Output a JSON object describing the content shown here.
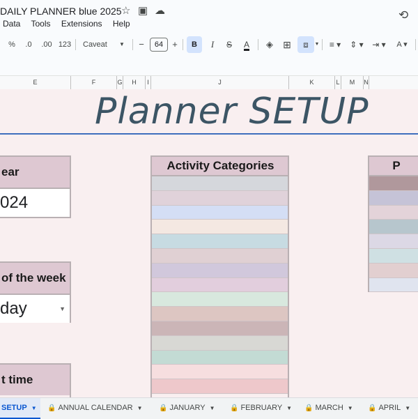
{
  "window": {
    "title": "DAILY PLANNER blue 2025",
    "menu": [
      "Data",
      "Tools",
      "Extensions",
      "Help"
    ]
  },
  "toolbar": {
    "percent": "%",
    "decrease_decimal": ".0",
    "increase_decimal": ".00",
    "number_format": "123",
    "font": "Caveat",
    "font_size": "64",
    "minus": "−",
    "plus": "+",
    "bold": "B",
    "italic": "I",
    "strike": "S",
    "text_color": "A",
    "text_rotate": "A"
  },
  "columns": [
    "E",
    "F",
    "G",
    "H",
    "I",
    "J",
    "K",
    "L",
    "M",
    "N"
  ],
  "banner": {
    "title": "Planner SETUP"
  },
  "year_box": {
    "header": "ear",
    "value": "024"
  },
  "week_box": {
    "header": " of the week",
    "value": "day"
  },
  "time_box": {
    "header": "t time"
  },
  "categories": {
    "header": "Activity Categories",
    "colors": [
      "#d5d7dc",
      "#e0d2da",
      "#d4def5",
      "#f4e8e2",
      "#c7dbe2",
      "#e0d0d3",
      "#d1c8dc",
      "#e2cedd",
      "#d8e8de",
      "#ddc6c2",
      "#cbb5b7",
      "#d8d8d4",
      "#c3dbd4",
      "#f6dedf",
      "#eec8cb"
    ]
  },
  "palette": {
    "header": "P",
    "colors": [
      "#b0989c",
      "#c5c3d7",
      "#e3d3d9",
      "#b7c6cd",
      "#dcd8e5",
      "#cfe0e3",
      "#e2cfd0",
      "#e0e4ef"
    ]
  },
  "sheet_tabs": [
    {
      "label": "SETUP",
      "locked": false,
      "active": true
    },
    {
      "label": "ANNUAL CALENDAR",
      "locked": true,
      "active": false
    },
    {
      "label": "JANUARY",
      "locked": true,
      "active": false
    },
    {
      "label": "FEBRUARY",
      "locked": true,
      "active": false
    },
    {
      "label": "MARCH",
      "locked": true,
      "active": false
    },
    {
      "label": "APRIL",
      "locked": true,
      "active": false
    }
  ]
}
